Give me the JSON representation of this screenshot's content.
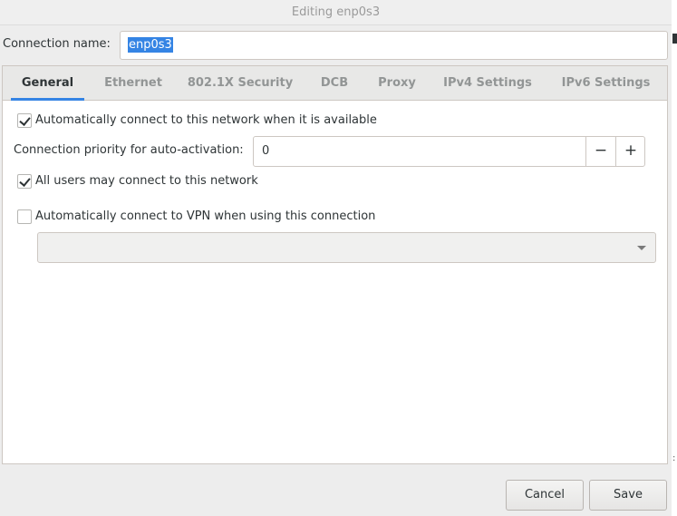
{
  "window": {
    "title": "Editing enp0s3"
  },
  "connection": {
    "label": "Connection name:",
    "value": "enp0s3"
  },
  "tabs": [
    {
      "label": "General",
      "active": true
    },
    {
      "label": "Ethernet",
      "active": false
    },
    {
      "label": "802.1X Security",
      "active": false
    },
    {
      "label": "DCB",
      "active": false
    },
    {
      "label": "Proxy",
      "active": false
    },
    {
      "label": "IPv4 Settings",
      "active": false
    },
    {
      "label": "IPv6 Settings",
      "active": false
    }
  ],
  "general": {
    "auto_connect": {
      "label": "Automatically connect to this network when it is available",
      "checked": true
    },
    "priority": {
      "label": "Connection priority for auto-activation:",
      "value": "0",
      "minus": "−",
      "plus": "+"
    },
    "all_users": {
      "label": "All users may connect to this network",
      "checked": true
    },
    "auto_vpn": {
      "label": "Automatically connect to VPN when using this connection",
      "checked": false
    },
    "vpn_select": {
      "value": ""
    }
  },
  "buttons": {
    "cancel": "Cancel",
    "save": "Save"
  },
  "colors": {
    "accent": "#3584e4"
  },
  "icons": {
    "minus": "minus-icon",
    "plus": "plus-icon",
    "dropdown": "chevron-down-icon",
    "checkmark": "checkmark-icon"
  }
}
